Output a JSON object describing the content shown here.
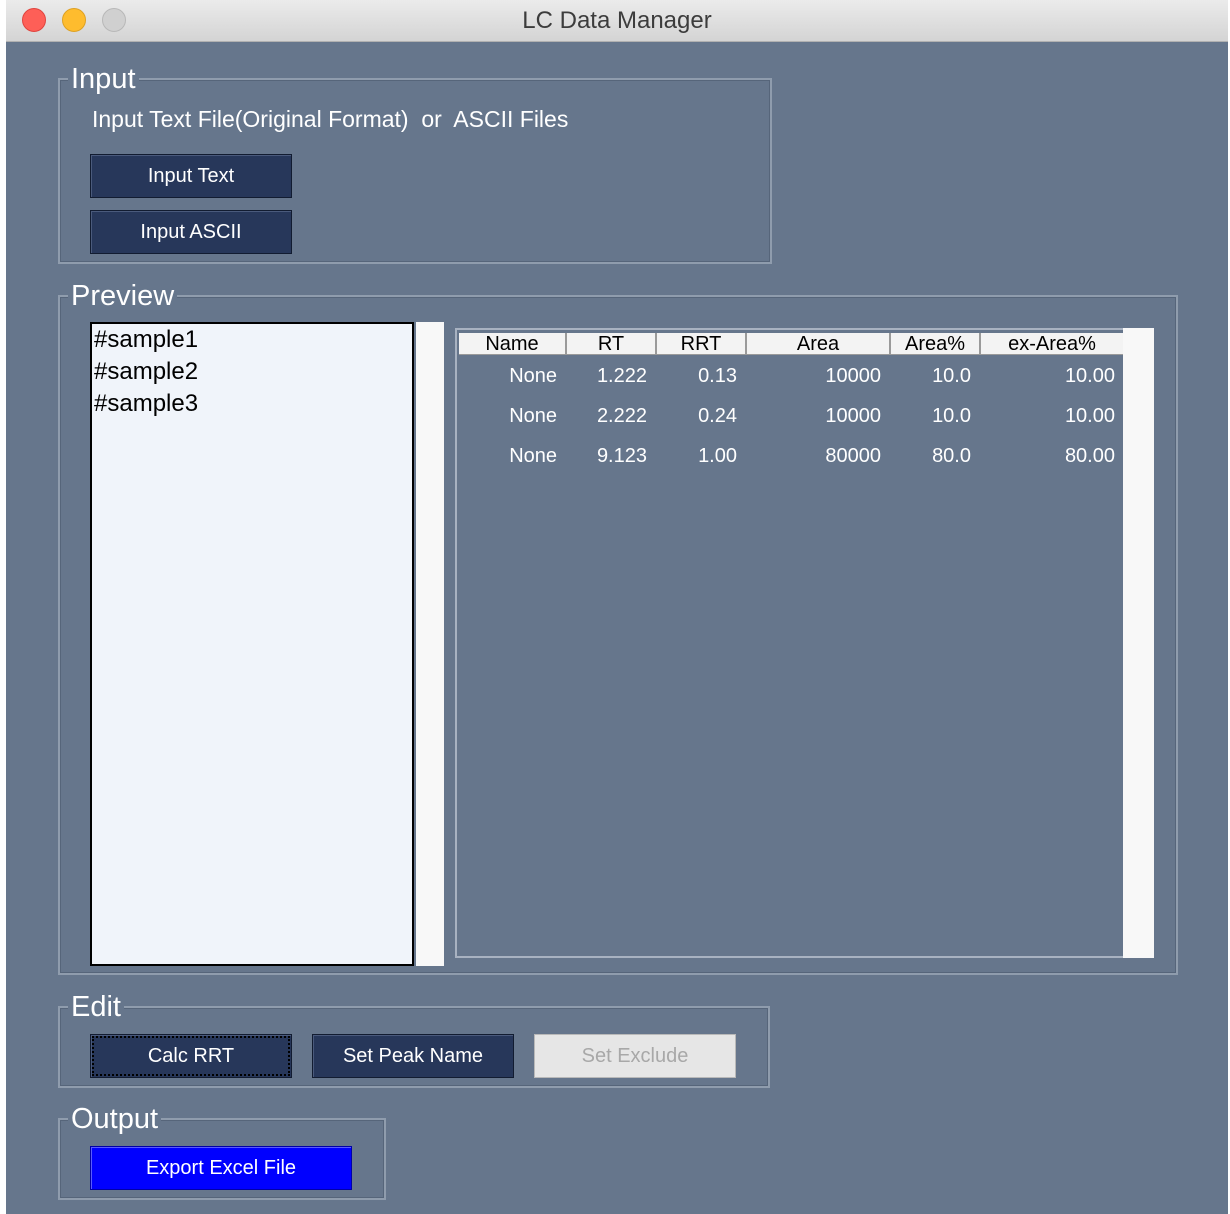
{
  "window": {
    "title": "LC Data Manager"
  },
  "input_group": {
    "legend": "Input",
    "description": "Input Text File(Original Format)  or  ASCII Files",
    "input_text_label": "Input Text",
    "input_ascii_label": "Input ASCII"
  },
  "preview_group": {
    "legend": "Preview",
    "samples": [
      "#sample1",
      "#sample2",
      "#sample3"
    ],
    "columns": [
      "Name",
      "RT",
      "RRT",
      "Area",
      "Area%",
      "ex-Area%"
    ],
    "rows": [
      [
        "None",
        "1.222",
        "0.13",
        "10000",
        "10.0",
        "10.00"
      ],
      [
        "None",
        "2.222",
        "0.24",
        "10000",
        "10.0",
        "10.00"
      ],
      [
        "None",
        "9.123",
        "1.00",
        "80000",
        "80.0",
        "80.00"
      ]
    ]
  },
  "edit_group": {
    "legend": "Edit",
    "calc_rrt_label": "Calc RRT",
    "set_peak_name_label": "Set Peak Name",
    "set_exclude_label": "Set Exclude"
  },
  "output_group": {
    "legend": "Output",
    "export_excel_label": "Export Excel File"
  },
  "colors": {
    "window_bg": "#66768c",
    "button_bg": "#27375a",
    "export_button_bg": "#0000ff",
    "list_bg": "#f0f4fa"
  }
}
